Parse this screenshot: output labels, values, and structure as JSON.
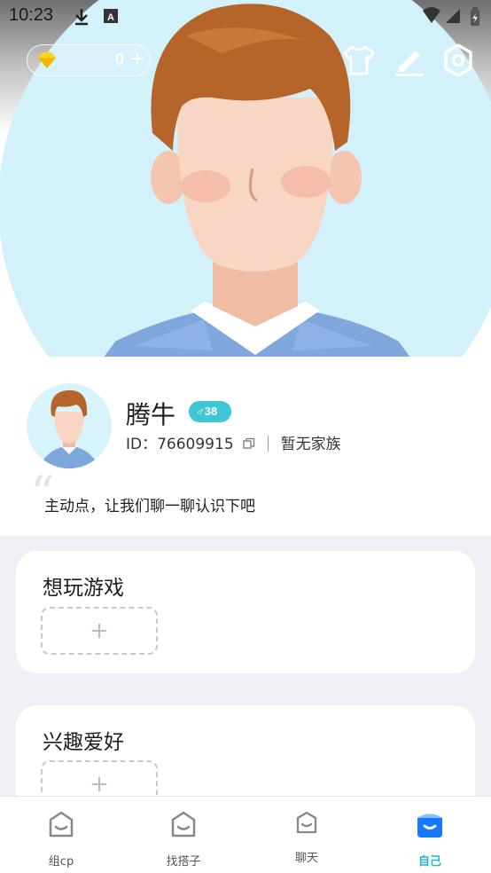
{
  "status_bar": {
    "time": "10:23"
  },
  "top_bar": {
    "gem_count": "0",
    "gem_add": "+",
    "actions": [
      "shirt-icon",
      "edit-icon",
      "settings-icon"
    ]
  },
  "profile": {
    "nickname": "腾牛",
    "gender_age": "♂38",
    "id_text": "ID：76609915",
    "family": "暂无家族",
    "signature": "主动点，让我们聊一聊认识下吧"
  },
  "sections": [
    {
      "title": "想玩游戏",
      "add": "+"
    },
    {
      "title": "兴趣爱好",
      "add": "+"
    }
  ],
  "tabs": [
    {
      "label": "组cp",
      "icon": "box-face-icon"
    },
    {
      "label": "找搭子",
      "icon": "box-face-icon"
    },
    {
      "label": "聊天",
      "icon": "box-face-icon"
    },
    {
      "label": "自己",
      "icon": "box-face-filled-icon",
      "active": true
    }
  ],
  "colors": {
    "accent": "#1fb5d8",
    "badge": "#3ec6d3",
    "active_tab_icon": "#1677ff"
  }
}
